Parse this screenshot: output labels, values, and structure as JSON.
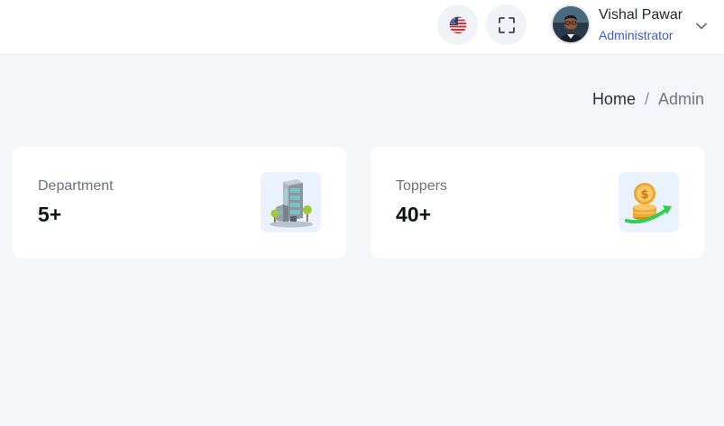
{
  "header": {
    "language_icon": "us-flag-icon",
    "fullscreen_icon": "fullscreen-icon",
    "user": {
      "name": "Vishal Pawar",
      "role": "Administrator",
      "avatar_icon": "avatar",
      "menu_icon": "chevron-down-icon"
    }
  },
  "breadcrumb": {
    "home": "Home",
    "separator": "/",
    "current": "Admin"
  },
  "cards": [
    {
      "label": "Department",
      "value": "5+",
      "icon": "building-icon",
      "icon_bg": "#eaf1ff"
    },
    {
      "label": "Toppers",
      "value": "40+",
      "icon": "coins-growth-icon",
      "icon_bg": "#eaf1ff"
    }
  ],
  "colors": {
    "page_bg": "#f5f6f9",
    "accent": "#3b5bdb",
    "card_bg": "#ffffff"
  }
}
